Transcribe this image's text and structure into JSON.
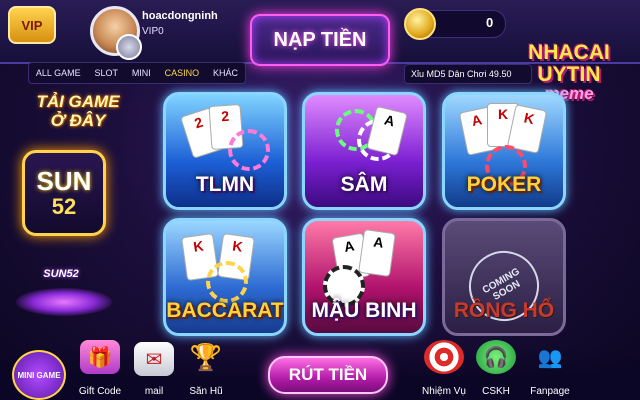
{
  "header": {
    "vip_badge": "VIP",
    "username": "hoacdongninh",
    "vip_level": "VIP0",
    "deposit_label": "NẠP TIỀN",
    "balance": "0"
  },
  "nav": {
    "tabs": [
      "ALL GAME",
      "SLOT",
      "MINI",
      "CASINO",
      "KHÁC"
    ],
    "active_tab": "CASINO"
  },
  "ticker": "Xỉu MD5 Dân Chơi 49.50",
  "promo": {
    "title_line1": "TẢI GAME",
    "title_line2": "Ở ĐÂY",
    "logo_line1": "SUN",
    "logo_line2": "52",
    "name": "SUN52"
  },
  "watermark": {
    "line1": "NHACAI",
    "line2": "UYTIN",
    "line3": "meme"
  },
  "games": [
    {
      "name": "TLMN"
    },
    {
      "name": "SÂM"
    },
    {
      "name": "POKER"
    },
    {
      "name": "BACCARAT"
    },
    {
      "name": "MẬU BINH"
    },
    {
      "name": "RỒNG HỔ",
      "badge": "COMING SOON"
    }
  ],
  "bottom": {
    "mini_game": "MINI GAME",
    "gift_code": "Gift Code",
    "mail": "mail",
    "jackpot": "Săn Hũ",
    "withdraw": "RÚT TIỀN",
    "missions": "Nhiệm Vụ",
    "support": "CSKH",
    "fanpage": "Fanpage"
  },
  "colors": {
    "accent_pink": "#ff5df0",
    "gold": "#ffd84a",
    "background": "#1c0f3d"
  }
}
